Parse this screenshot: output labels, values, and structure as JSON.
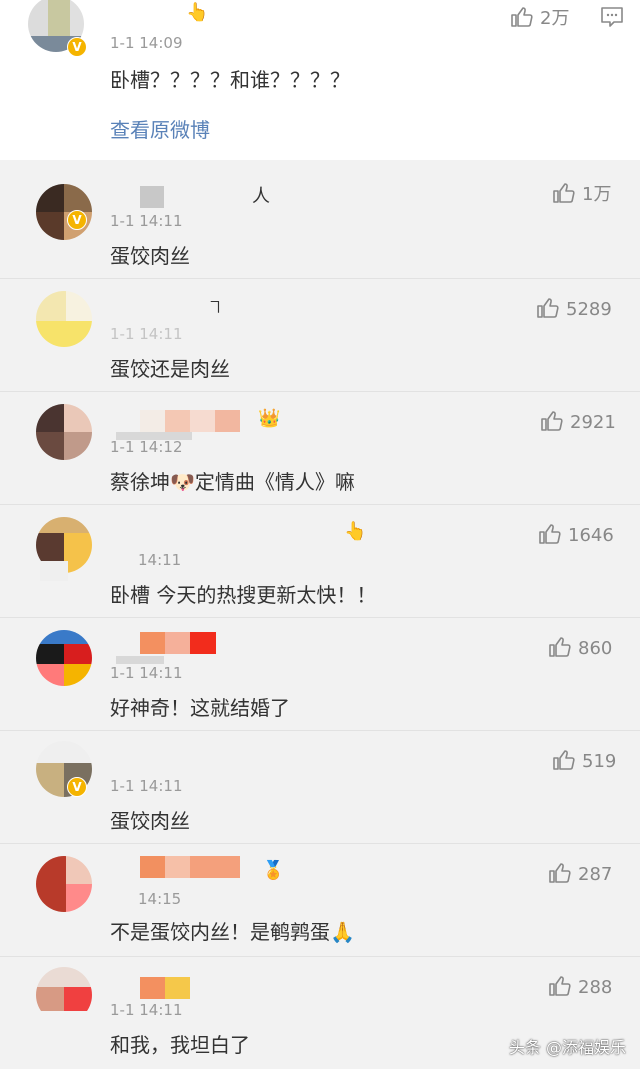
{
  "original": {
    "timestamp": "1-1 14:09",
    "text": "卧槽？？？？和谁？？？？",
    "likes": "2万",
    "view_original": "查看原微博"
  },
  "comments": [
    {
      "name_char": "人",
      "timestamp": "1-1 14:11",
      "text": "蛋饺肉丝",
      "likes": "1万"
    },
    {
      "name_char": "ヿ",
      "timestamp": "1-1 14:11",
      "text": "蛋饺还是肉丝",
      "likes": "5289"
    },
    {
      "timestamp": "1-1 14:12",
      "text_before": "蔡徐坤",
      "text_after": "定情曲《情人》嘛",
      "likes": "2921"
    },
    {
      "timestamp": "14:11",
      "text": "卧槽 今天的热搜更新太快！！",
      "likes": "1646"
    },
    {
      "timestamp": "1-1 14:11",
      "text": "好神奇！这就结婚了",
      "likes": "860"
    },
    {
      "timestamp": "1-1 14:11",
      "text": "蛋饺肉丝",
      "likes": "519"
    },
    {
      "timestamp": "14:15",
      "text": "不是蛋饺内丝！是鹌鹑蛋",
      "likes": "287"
    },
    {
      "timestamp": "1-1 14:11",
      "text": "和我，我坦白了",
      "likes": "288"
    }
  ],
  "watermark": "头条 @添福娱乐",
  "colors": {
    "link": "#5a82b8",
    "badge": "#f5b400",
    "background": "#f2f2f2"
  }
}
